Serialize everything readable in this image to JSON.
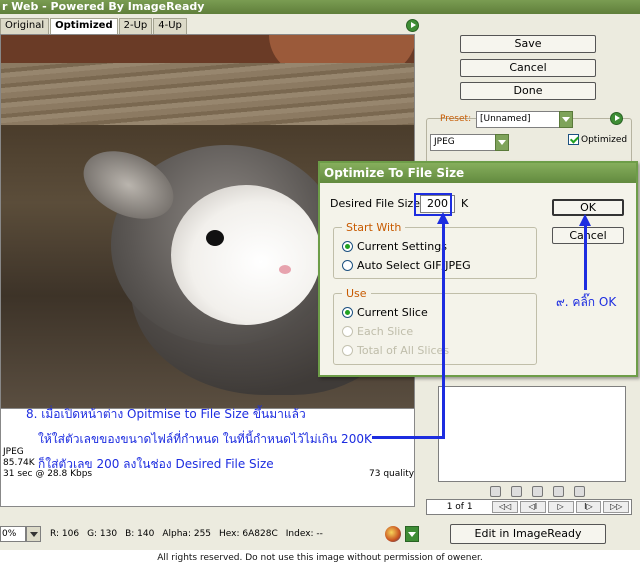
{
  "window": {
    "title": "r Web - Powered By ImageReady"
  },
  "tabs": [
    {
      "label": "Original"
    },
    {
      "label": "Optimized"
    },
    {
      "label": "2-Up"
    },
    {
      "label": "4-Up"
    }
  ],
  "actions": {
    "save": "Save",
    "cancel": "Cancel",
    "done": "Done"
  },
  "settings": {
    "preset_label": "Preset:",
    "preset_value": "[Unnamed]",
    "format_value": "JPEG",
    "optimized_label": "Optimized",
    "optimized_checked": true
  },
  "image_info": {
    "format": "JPEG",
    "size": "85.74K",
    "time": "31 sec @ 28.8 Kbps",
    "quality": "73 quality"
  },
  "status": {
    "zoom": "0%",
    "r": "R: 106",
    "g": "G: 130",
    "b": "B: 140",
    "alpha": "Alpha: 255",
    "hex": "Hex: 6A828C",
    "index": "Index: --",
    "edit_button": "Edit in ImageReady"
  },
  "animation": {
    "frame": "1 of 1"
  },
  "dialog": {
    "title": "Optimize To File Size",
    "desired_label": "Desired File Size:",
    "desired_value": "200",
    "unit": "K",
    "ok": "OK",
    "cancel": "Cancel",
    "start_with": {
      "legend": "Start With",
      "options": [
        "Current Settings",
        "Auto Select GIF/JPEG"
      ],
      "selected": "Current Settings"
    },
    "use": {
      "legend": "Use",
      "options": [
        "Current Slice",
        "Each Slice",
        "Total of All Slices"
      ],
      "selected": "Current Slice"
    }
  },
  "annotations": {
    "click_ok": "๙. คลิ๊ก OK",
    "line1": "8. เมื่อเปิดหน้าต่าง Opitmise to File Size ขึ้นมาแล้ว",
    "line2": "ให้ใส่ตัวเลขของขนาดไฟล์ที่กำหนด ในที่นี้กำหนดไว้ไม่เกิน 200K",
    "line3": "ก็ใส่ตัวเลข 200 ลงในช่อง Desired File Size",
    "color": "#1d2de0"
  },
  "footer": "All rights reserved. Do not use this image without permission of owener."
}
